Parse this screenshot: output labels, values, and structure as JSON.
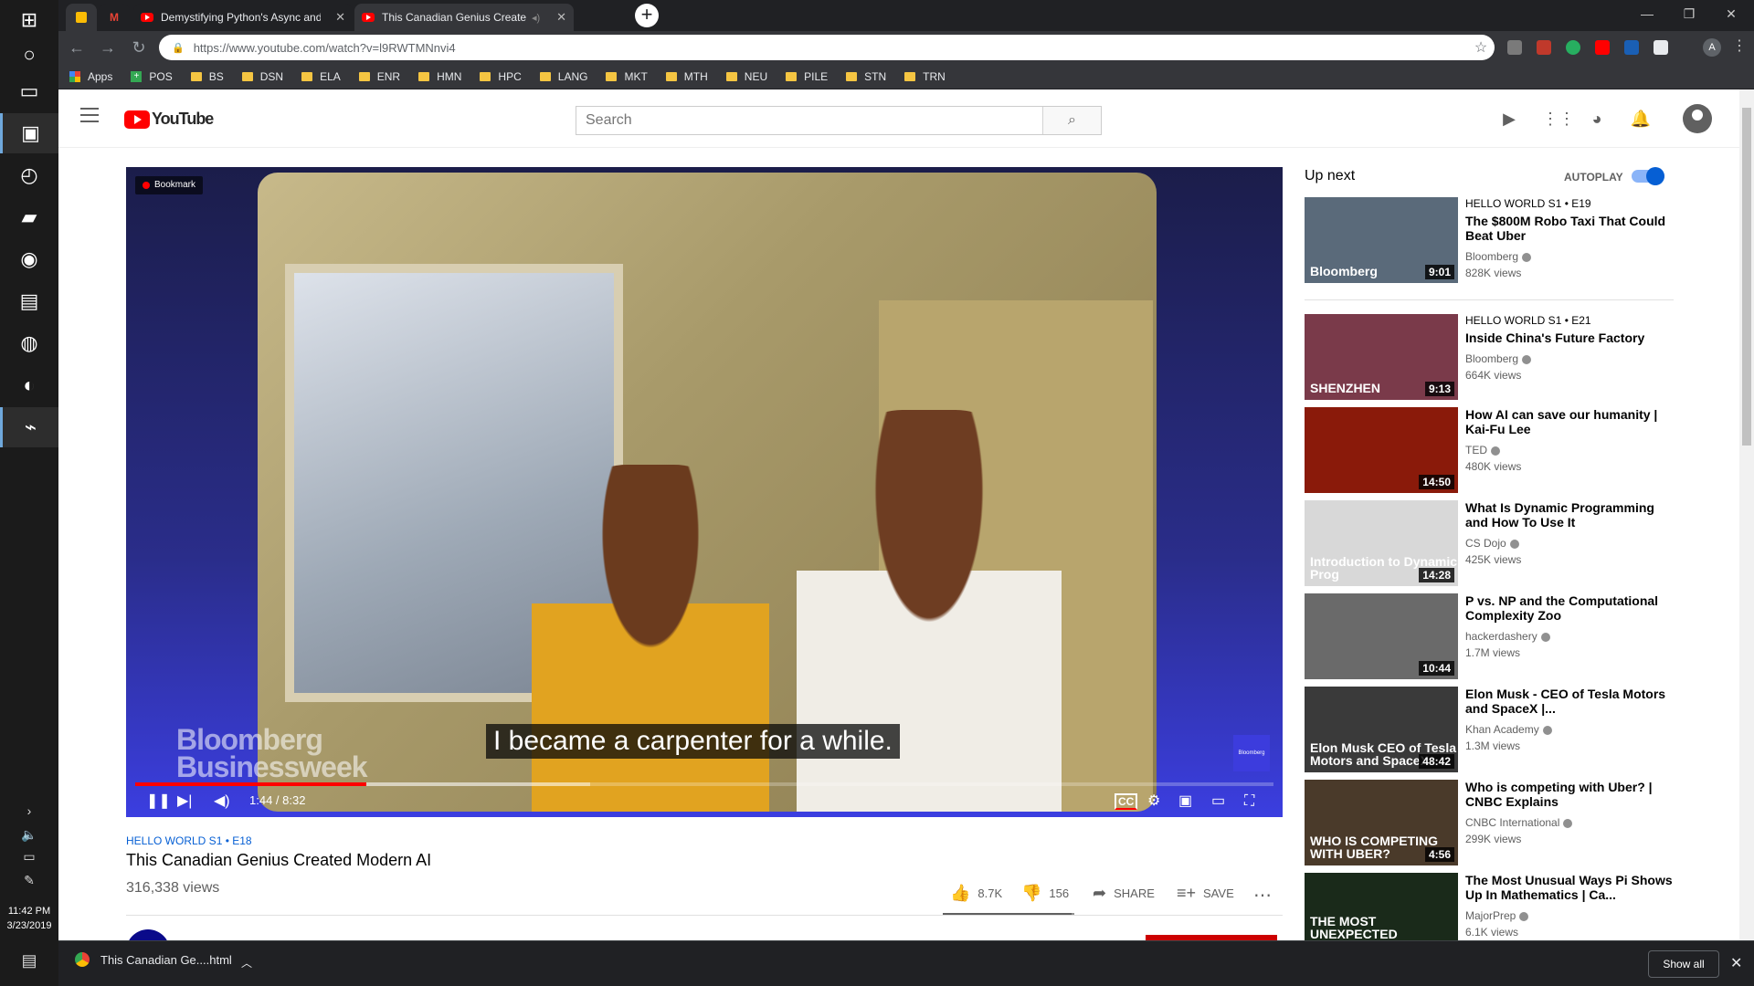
{
  "taskbar": {
    "clock_time": "11:42 PM",
    "clock_date": "3/23/2019"
  },
  "browser": {
    "tabs": [
      {
        "label": "Demystifying Python's Async and",
        "pinned": false
      },
      {
        "label": "This Canadian Genius Create",
        "pinned": false
      }
    ],
    "url": "https://www.youtube.com/watch?v=l9RWTMNnvi4",
    "profile_initial": "A",
    "bookmarks": [
      "Apps",
      "POS",
      "BS",
      "DSN",
      "ELA",
      "ENR",
      "HMN",
      "HPC",
      "LANG",
      "MKT",
      "MTH",
      "NEU",
      "PILE",
      "STN",
      "TRN"
    ]
  },
  "youtube": {
    "logo_text": "YouTube",
    "search_placeholder": "Search"
  },
  "player": {
    "bookmark_chip": "Bookmark",
    "watermark_line1": "Bloomberg",
    "watermark_line2": "Businessweek",
    "caption": "I became a carpenter for a while.",
    "corner_logo": "Bloomberg",
    "time": "1:44 / 8:32",
    "progress": 0.203,
    "loaded": 0.4
  },
  "video": {
    "series": "HELLO WORLD  S1 • E18",
    "title": "This Canadian Genius Created Modern AI",
    "views": "316,338 views",
    "likes": "8.7K",
    "dislikes": "156",
    "share_label": "SHARE",
    "save_label": "SAVE",
    "like_ratio": 0.98
  },
  "sidebar": {
    "up_next_label": "Up next",
    "autoplay_label": "AUTOPLAY",
    "items": [
      {
        "series": "HELLO WORLD  S1 • E19",
        "title": "The $800M Robo Taxi That Could Beat Uber",
        "channel": "Bloomberg",
        "views": "828K views",
        "duration": "9:01",
        "thumb_text": "Bloomberg",
        "thumb_color": "#5a6a7a"
      },
      {
        "series": "HELLO WORLD  S1 • E21",
        "title": "Inside China's Future Factory",
        "channel": "Bloomberg",
        "views": "664K views",
        "duration": "9:13",
        "thumb_text": "SHENZHEN",
        "thumb_color": "#7a3a4a"
      },
      {
        "series": "",
        "title": "How AI can save our humanity | Kai-Fu Lee",
        "channel": "TED",
        "views": "480K views",
        "duration": "14:50",
        "thumb_text": "",
        "thumb_color": "#8a1a0a"
      },
      {
        "series": "",
        "title": "What Is Dynamic Programming and How To Use It",
        "channel": "CS Dojo",
        "views": "425K views",
        "duration": "14:28",
        "thumb_text": "Introduction to Dynamic Prog",
        "thumb_color": "#d8d8d8"
      },
      {
        "series": "",
        "title": "P vs. NP and the Computational Complexity Zoo",
        "channel": "hackerdashery",
        "views": "1.7M views",
        "duration": "10:44",
        "thumb_text": "",
        "thumb_color": "#6a6a6a"
      },
      {
        "series": "",
        "title": "Elon Musk - CEO of Tesla Motors and SpaceX |...",
        "channel": "Khan Academy",
        "views": "1.3M views",
        "duration": "48:42",
        "thumb_text": "Elon Musk CEO of Tesla Motors and SpaceX",
        "thumb_color": "#3a3a3a"
      },
      {
        "series": "",
        "title": "Who is competing with Uber? | CNBC Explains",
        "channel": "CNBC International",
        "views": "299K views",
        "duration": "4:56",
        "thumb_text": "WHO IS COMPETING WITH UBER?",
        "thumb_color": "#4a3a2a"
      },
      {
        "series": "",
        "title": "The Most Unusual Ways Pi Shows Up In Mathematics | Ca...",
        "channel": "MajorPrep",
        "views": "6.1K views",
        "duration": "",
        "thumb_text": "THE MOST UNEXPECTED APPLICATIONS OF PI",
        "thumb_color": "#1a2a1a"
      }
    ]
  },
  "downloads": {
    "file": "This Canadian Ge....html",
    "show_all": "Show all"
  }
}
